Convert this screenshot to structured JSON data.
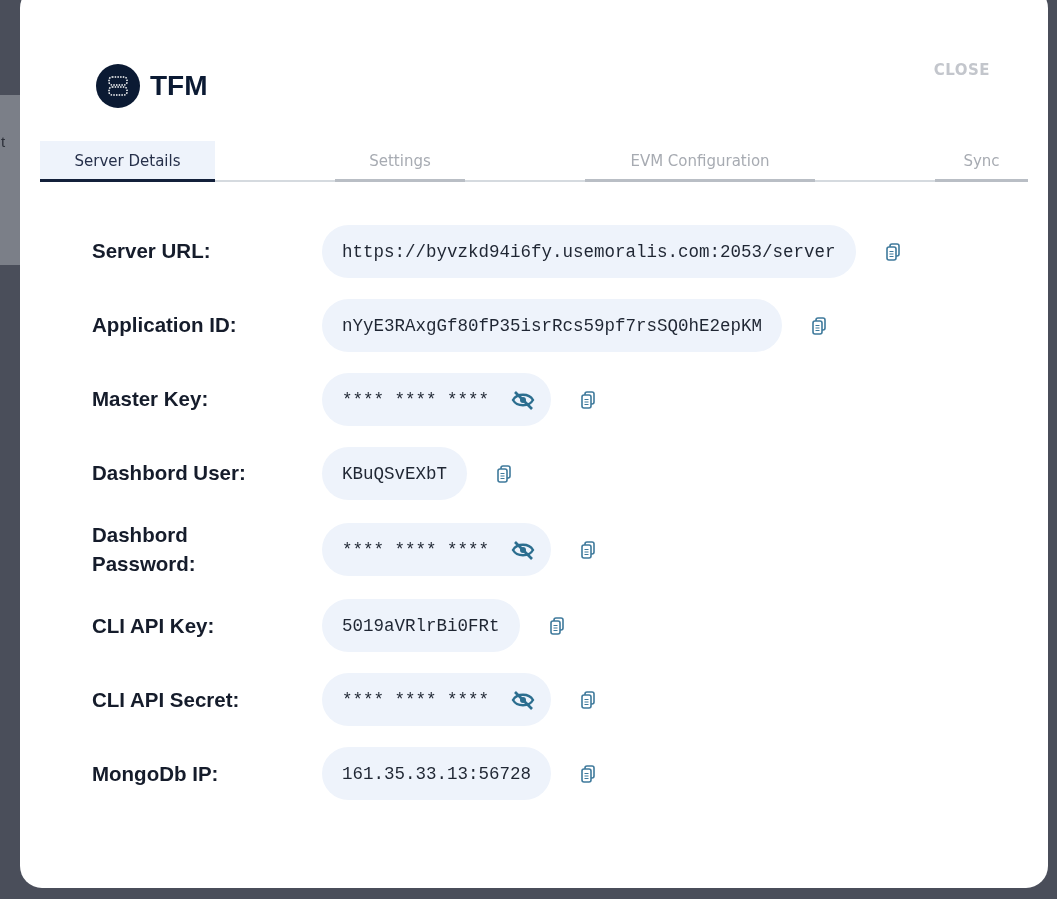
{
  "backdrop_text": "t",
  "header": {
    "logo_text": "TFM",
    "close": "CLOSE"
  },
  "tabs": [
    {
      "label": "Server Details",
      "selected": true
    },
    {
      "label": "Settings",
      "selected": false
    },
    {
      "label": "EVM Configuration",
      "selected": false
    },
    {
      "label": "Sync",
      "selected": false
    }
  ],
  "fields": [
    {
      "label": "Server URL:",
      "kind": "text",
      "value": "https://byvzkd94i6fy.usemoralis.com:2053/server"
    },
    {
      "label": "Application ID:",
      "kind": "text",
      "value": "nYyE3RAxgGf80fP35isrRcs59pf7rsSQ0hE2epKM"
    },
    {
      "label": "Master Key:",
      "kind": "secret",
      "value": "**** **** ****"
    },
    {
      "label": "Dashbord User:",
      "kind": "text",
      "value": "KBuQSvEXbT"
    },
    {
      "label": "Dashbord Password:",
      "kind": "secret",
      "value": "**** **** ****"
    },
    {
      "label": "CLI API Key:",
      "kind": "text",
      "value": "5019aVRlrBi0FRt"
    },
    {
      "label": "CLI API Secret:",
      "kind": "secret",
      "value": "**** **** ****"
    },
    {
      "label": "MongoDb IP:",
      "kind": "text",
      "value": "161.35.33.13:56728"
    }
  ]
}
